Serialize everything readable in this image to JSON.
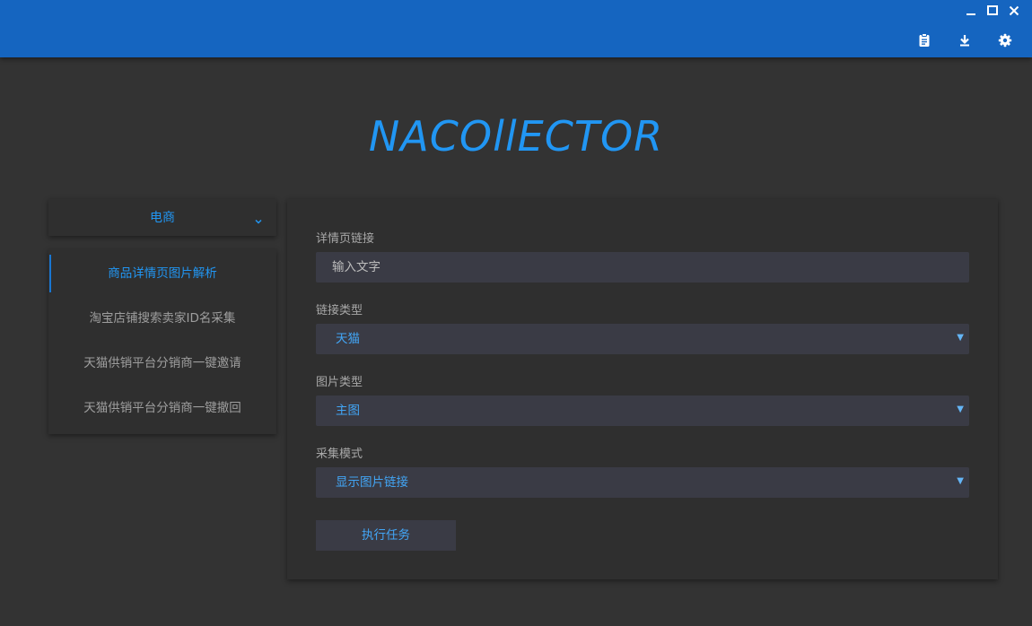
{
  "app": {
    "logo_text": "NACOllECTOR",
    "accent_color": "#2196f3",
    "titlebar_color": "#1565c0",
    "background_color": "#333333"
  },
  "window_controls": [
    {
      "icon": "minimize-icon"
    },
    {
      "icon": "maximize-icon"
    },
    {
      "icon": "close-icon"
    }
  ],
  "toolbar": [
    {
      "icon": "clipboard-icon"
    },
    {
      "icon": "download-icon"
    },
    {
      "icon": "gear-icon"
    }
  ],
  "sidebar": {
    "category": {
      "label": "电商",
      "icon": "chevron-down-icon"
    },
    "items": [
      {
        "label": "商品详情页图片解析",
        "active": true
      },
      {
        "label": "淘宝店铺搜索卖家ID名采集",
        "active": false
      },
      {
        "label": "天猫供销平台分销商一键邀请",
        "active": false
      },
      {
        "label": "天猫供销平台分销商一键撤回",
        "active": false
      }
    ]
  },
  "form": {
    "detail_link": {
      "label": "详情页链接",
      "value": "输入文字"
    },
    "link_type": {
      "label": "链接类型",
      "value": "天猫"
    },
    "image_type": {
      "label": "图片类型",
      "value": "主图"
    },
    "collect_mode": {
      "label": "采集模式",
      "value": "显示图片链接"
    },
    "submit_label": "执行任务"
  }
}
